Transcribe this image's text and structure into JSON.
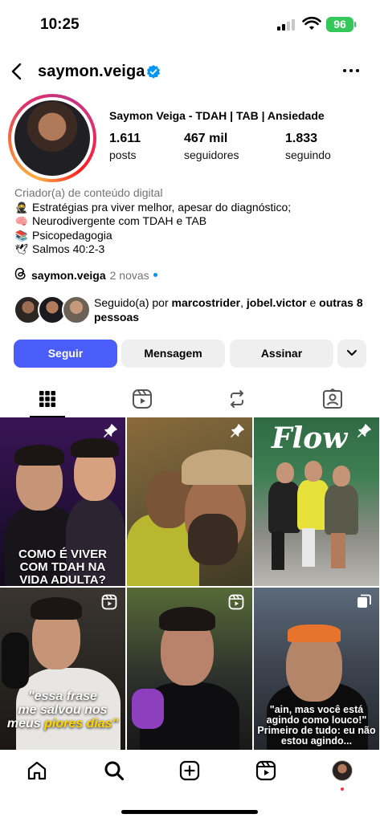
{
  "status_bar": {
    "time": "10:25",
    "battery": "96"
  },
  "header": {
    "username": "saymon.veiga"
  },
  "profile": {
    "full_name": "Saymon Veiga - TDAH | TAB | Ansiedade",
    "stats": [
      {
        "value": "1.611",
        "label": "posts"
      },
      {
        "value": "467 mil",
        "label": "seguidores"
      },
      {
        "value": "1.833",
        "label": "seguindo"
      }
    ],
    "category": "Criador(a) de conteúdo digital",
    "bio_lines": [
      {
        "emoji": "🥷",
        "text": "Estratégias pra viver melhor, apesar do diagnóstico;"
      },
      {
        "emoji": "🧠",
        "text": "Neurodivergente com TDAH e TAB"
      },
      {
        "emoji": "📚",
        "text": "Psicopedagogia"
      },
      {
        "emoji": "🕊",
        "text": "Salmos 40:2-3"
      }
    ],
    "threads": {
      "handle": "saymon.veiga",
      "new": "2 novas"
    },
    "followed_by": {
      "prefix": "Seguido(a) por ",
      "user1": "marcostrider",
      "sep": ", ",
      "user2": "jobel.victor",
      "mid": " e ",
      "others": "outras 8 pessoas"
    }
  },
  "buttons": {
    "follow": "Seguir",
    "message": "Mensagem",
    "subscribe": "Assinar"
  },
  "tabs": [
    "grid",
    "reels",
    "reposts",
    "tagged"
  ],
  "posts": [
    {
      "caption": "COMO É VIVER COM TDAH NA VIDA ADULTA?",
      "badge": "pin-icon"
    },
    {
      "caption": "",
      "badge": "pin-icon"
    },
    {
      "caption": "Flow",
      "badge": "pin-icon"
    },
    {
      "caption_lines": [
        "\"essa frase",
        "me salvou nos",
        "meus ",
        "piores dias\""
      ],
      "badge": "reels-icon"
    },
    {
      "caption": "",
      "badge": "reels-icon"
    },
    {
      "caption_lines": [
        "\"ain, mas você está",
        "agindo como louco!\"",
        "Primeiro de tudo: eu não",
        "estou agindo..."
      ],
      "badge": "carousel-icon"
    }
  ],
  "colors": {
    "primary_button": "#4a5df9",
    "verified": "#0095f6",
    "battery": "#34c759",
    "highlight_yellow": "#ffd400"
  }
}
